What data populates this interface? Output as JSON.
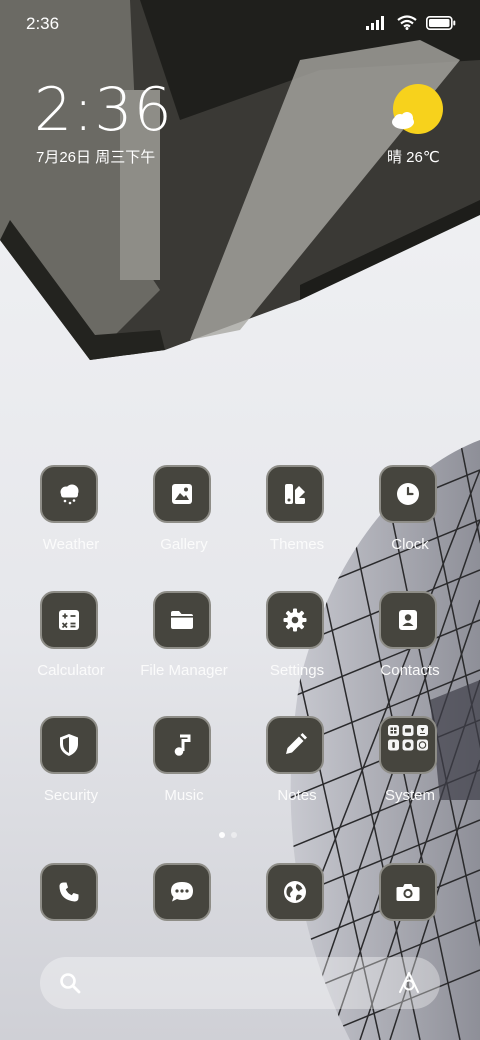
{
  "status_bar": {
    "time": "2:36"
  },
  "clock_widget": {
    "time": "2:36",
    "date": "7月26日 周三下午"
  },
  "weather_widget": {
    "text": "晴 26℃",
    "icon": "sun-cloud-icon",
    "sun_color": "#f7d21c"
  },
  "apps": [
    {
      "label": "Weather",
      "icon": "weather-icon"
    },
    {
      "label": "Gallery",
      "icon": "gallery-icon"
    },
    {
      "label": "Themes",
      "icon": "themes-icon"
    },
    {
      "label": "Clock",
      "icon": "clock-icon"
    },
    {
      "label": "Calculator",
      "icon": "calculator-icon"
    },
    {
      "label": "File Manager",
      "icon": "folder-icon"
    },
    {
      "label": "Settings",
      "icon": "gear-icon"
    },
    {
      "label": "Contacts",
      "icon": "contacts-icon"
    },
    {
      "label": "Security",
      "icon": "shield-icon"
    },
    {
      "label": "Music",
      "icon": "music-icon"
    },
    {
      "label": "Notes",
      "icon": "pencil-icon"
    },
    {
      "label": "System",
      "icon": "folder-grid-icon"
    }
  ],
  "dock": [
    {
      "icon": "phone-icon"
    },
    {
      "icon": "message-icon"
    },
    {
      "icon": "browser-icon"
    },
    {
      "icon": "camera-icon"
    }
  ],
  "page_indicator": {
    "pages": 2,
    "current": 1
  },
  "colors": {
    "tile": "#46453e",
    "tile_border": "#8e8d87"
  }
}
